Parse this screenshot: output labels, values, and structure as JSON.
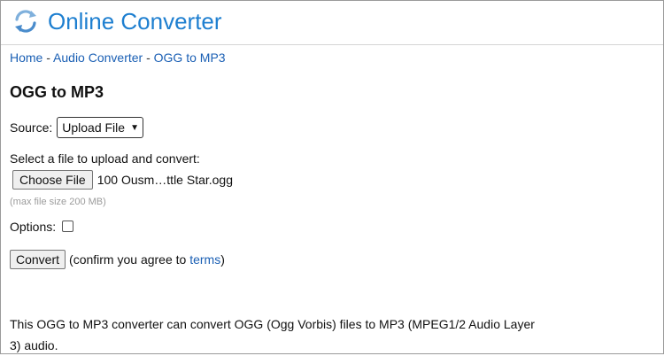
{
  "header": {
    "logo_icon": "refresh-arrows-icon",
    "brand": "Online Converter",
    "brand_color": "#1e7fd0"
  },
  "breadcrumb": {
    "home": "Home",
    "sep": " - ",
    "audio": "Audio Converter",
    "current": "OGG to MP3"
  },
  "page": {
    "title": "OGG to MP3"
  },
  "form": {
    "source_label": "Source:",
    "source_selected": "Upload File",
    "upload_prompt": "Select a file to upload and convert:",
    "choose_file_label": "Choose File",
    "file_name": "100 Ousm…ttle Star.ogg",
    "max_size": "(max file size 200 MB)",
    "options_label": "Options:",
    "options_checked": false,
    "convert_label": "Convert",
    "confirm_prefix": "(confirm you agree to ",
    "terms_link": "terms",
    "confirm_suffix": ")"
  },
  "description": "This OGG to MP3 converter can convert OGG (Ogg Vorbis) files to MP3 (MPEG1/2 Audio Layer 3) audio.",
  "colors": {
    "link": "#1a5fb4",
    "muted": "#9b9b9b"
  }
}
